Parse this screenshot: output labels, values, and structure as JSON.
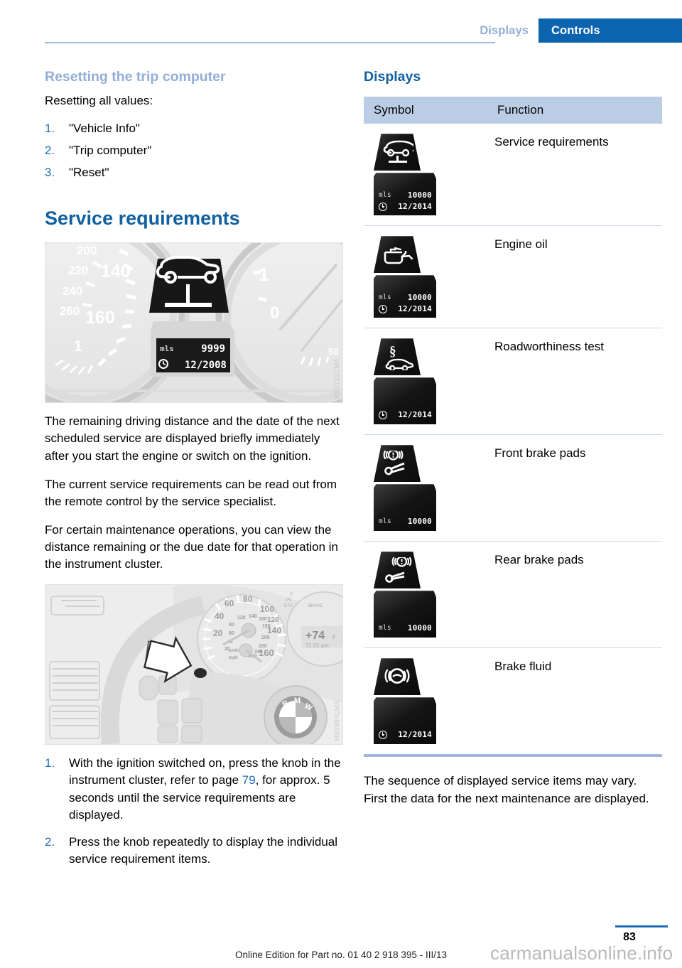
{
  "header": {
    "tabs": [
      {
        "label": "Displays",
        "active": false
      },
      {
        "label": "Controls",
        "active": true
      }
    ],
    "accent_blue": "#0C63AE",
    "muted_blue": "#93AED6"
  },
  "left_column": {
    "subheading": "Resetting the trip computer",
    "lead": "Resetting all values:",
    "reset_steps": [
      {
        "num": "1.",
        "text": "\"Vehicle Info\""
      },
      {
        "num": "2.",
        "text": "\"Trip computer\""
      },
      {
        "num": "3.",
        "text": "\"Reset\""
      }
    ],
    "heading": "Service requirements",
    "figure1": {
      "code": "MX0723CMA",
      "alt": "Instrument cluster with service-requirements symbol",
      "display": {
        "unit": "mls",
        "distance": "9999",
        "date": "12/2008"
      },
      "speedo_ticks": [
        "200",
        "220",
        "240",
        "260",
        "140",
        "160",
        "1"
      ],
      "tach_ticks": [
        "1",
        "0",
        "50"
      ]
    },
    "paragraphs": [
      "The remaining driving distance and the date of the next scheduled service are displayed briefly immediately after you start the engine or switch on the ignition.",
      "The current service requirements can be read out from the remote control by the service specialist.",
      "For certain maintenance operations, you can view the distance remaining or the due date for that operation in the instrument cluster."
    ],
    "figure2": {
      "code": "MX0904CMA",
      "alt": "Steering wheel and instrument cluster knob",
      "cluster_labels": [
        "20",
        "40",
        "60",
        "80",
        "100",
        "120",
        "140",
        "160",
        "180",
        "200",
        "220",
        "240",
        "260",
        "DTC",
        "BRAKE",
        "+74",
        "11:15 am"
      ],
      "brand": "BMW"
    },
    "instruction_steps": [
      {
        "num": "1.",
        "text_before": "With the ignition switched on, press the knob in the instrument cluster, refer to page ",
        "link": "79",
        "text_after": ", for approx. 5 seconds until the service requirements are displayed."
      },
      {
        "num": "2.",
        "text_before": "Press the knob repeatedly to display the individual service requirement items.",
        "link": "",
        "text_after": ""
      }
    ]
  },
  "right_column": {
    "heading": "Displays",
    "table": {
      "columns": [
        "Symbol",
        "Function"
      ],
      "rows": [
        {
          "function": "Service requirements",
          "icon": "car-on-lift-icon",
          "readout": {
            "unit": "mls",
            "distance": "10000",
            "date": "12/2014"
          }
        },
        {
          "function": "Engine oil",
          "icon": "oil-can-icon",
          "readout": {
            "unit": "mls",
            "distance": "10000",
            "date": "12/2014"
          }
        },
        {
          "function": "Roadworthiness test",
          "icon": "paragraph-car-icon",
          "readout": {
            "unit": "",
            "distance": "",
            "date": "12/2014"
          }
        },
        {
          "function": "Front brake pads",
          "icon": "front-brake-pad-icon",
          "readout": {
            "unit": "mls",
            "distance": "10000",
            "date": ""
          }
        },
        {
          "function": "Rear brake pads",
          "icon": "rear-brake-pad-icon",
          "readout": {
            "unit": "mls",
            "distance": "10000",
            "date": ""
          }
        },
        {
          "function": "Brake fluid",
          "icon": "brake-fluid-icon",
          "readout": {
            "unit": "",
            "distance": "",
            "date": "12/2014"
          }
        }
      ]
    },
    "note": "The sequence of displayed service items may vary. First the data for the next maintenance are displayed."
  },
  "footer": {
    "page_number": "83",
    "edition": "Online Edition for Part no. 01 40 2 918 395 - III/13",
    "watermark": "carmanualsonline.info"
  }
}
